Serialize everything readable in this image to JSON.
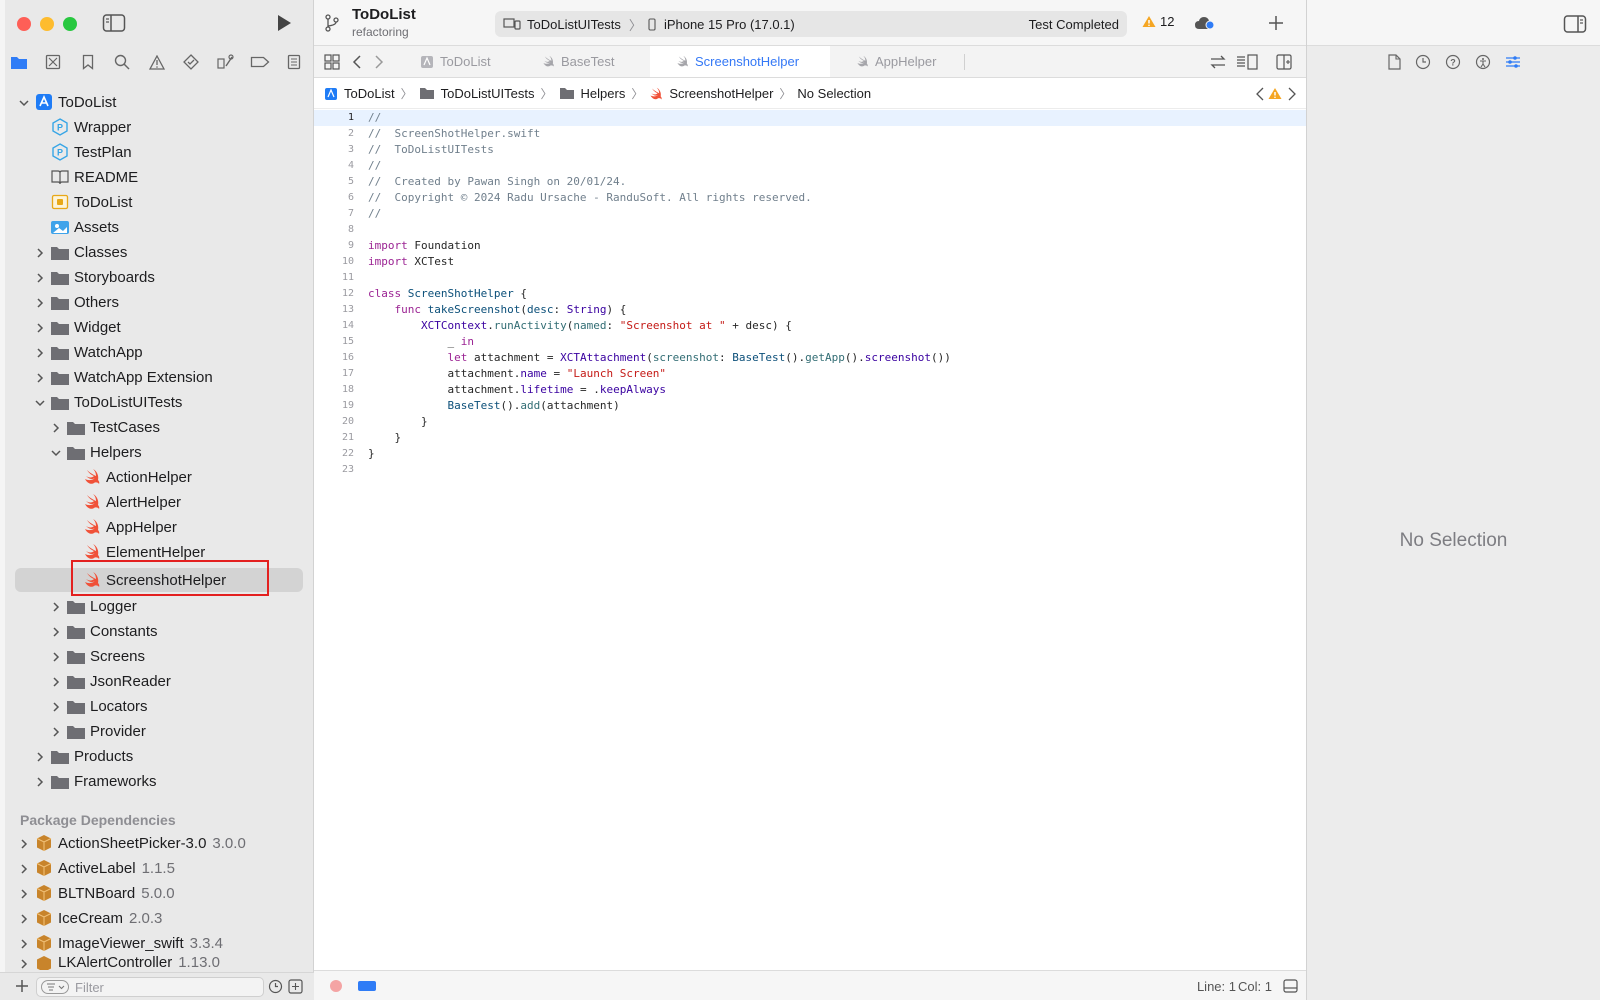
{
  "toolbar": {
    "project_name": "ToDoList",
    "branch": "refactoring",
    "scheme": "ToDoListUITests",
    "destination": "iPhone 15 Pro (17.0.1)",
    "status": "Test Completed",
    "warning_count": "12"
  },
  "tabs": [
    {
      "label": "ToDoList"
    },
    {
      "label": "BaseTest"
    },
    {
      "label": "ScreenshotHelper"
    },
    {
      "label": "AppHelper"
    }
  ],
  "breadcrumbs": [
    "ToDoList",
    "ToDoListUITests",
    "Helpers",
    "ScreenshotHelper",
    "No Selection"
  ],
  "navigator": {
    "items": [
      {
        "label": "ToDoList"
      },
      {
        "label": "Wrapper"
      },
      {
        "label": "TestPlan"
      },
      {
        "label": "README"
      },
      {
        "label": "ToDoList"
      },
      {
        "label": "Assets"
      },
      {
        "label": "Classes"
      },
      {
        "label": "Storyboards"
      },
      {
        "label": "Others"
      },
      {
        "label": "Widget"
      },
      {
        "label": "WatchApp"
      },
      {
        "label": "WatchApp Extension"
      },
      {
        "label": "ToDoListUITests"
      },
      {
        "label": "TestCases"
      },
      {
        "label": "Helpers"
      },
      {
        "label": "ActionHelper"
      },
      {
        "label": "AlertHelper"
      },
      {
        "label": "AppHelper"
      },
      {
        "label": "ElementHelper"
      },
      {
        "label": "ScreenshotHelper"
      },
      {
        "label": "Logger"
      },
      {
        "label": "Constants"
      },
      {
        "label": "Screens"
      },
      {
        "label": "JsonReader"
      },
      {
        "label": "Locators"
      },
      {
        "label": "Provider"
      },
      {
        "label": "Products"
      },
      {
        "label": "Frameworks"
      }
    ],
    "packages_header": "Package Dependencies",
    "packages": [
      {
        "name": "ActionSheetPicker-3.0",
        "version": "3.0.0"
      },
      {
        "name": "ActiveLabel",
        "version": "1.1.5"
      },
      {
        "name": "BLTNBoard",
        "version": "5.0.0"
      },
      {
        "name": "IceCream",
        "version": "2.0.3"
      },
      {
        "name": "ImageViewer_swift",
        "version": "3.3.4"
      },
      {
        "name": "LKAlertController",
        "version": "1.13.0"
      }
    ],
    "filter_placeholder": "Filter"
  },
  "code_lines": [
    "1",
    "2",
    "3",
    "4",
    "5",
    "6",
    "7",
    "8",
    "9",
    "10",
    "11",
    "12",
    "13",
    "14",
    "15",
    "16",
    "17",
    "18",
    "19",
    "20",
    "21",
    "22",
    "23"
  ],
  "code_text": {
    "l1": "//",
    "l2": "//  ScreenShotHelper.swift",
    "l3": "//  ToDoListUITests",
    "l4": "//",
    "l5": "//  Created by Pawan Singh on 20/01/24.",
    "l6": "//  Copyright © 2024 Radu Ursache - RanduSoft. All rights reserved.",
    "l7": "//",
    "kw_import": "import",
    "foundation": "Foundation",
    "xctest": "XCTest",
    "kw_class": "class",
    "class_name": "ScreenShotHelper",
    "kw_func": "func",
    "func_name": "takeScreenshot",
    "param": "desc",
    "type_string": "String",
    "xctcontext": "XCTContext",
    "run_activity": "runActivity",
    "named": "named",
    "str_screenshot_at": "\"Screenshot at \"",
    "kw_in": "in",
    "kw_let": "let",
    "attachment": "attachment",
    "xctattachment": "XCTAttachment",
    "screenshot_label": "screenshot",
    "basetest": "BaseTest",
    "getapp": "getApp",
    "screenshot_method": "screenshot",
    "prop_name": "name",
    "str_launch": "\"Launch Screen\"",
    "prop_lifetime": "lifetime",
    "keep_always": "keepAlways",
    "add": "add"
  },
  "status_bar": {
    "line": "Line: 1",
    "col": "Col: 1"
  },
  "inspector": {
    "empty_text": "No Selection"
  }
}
